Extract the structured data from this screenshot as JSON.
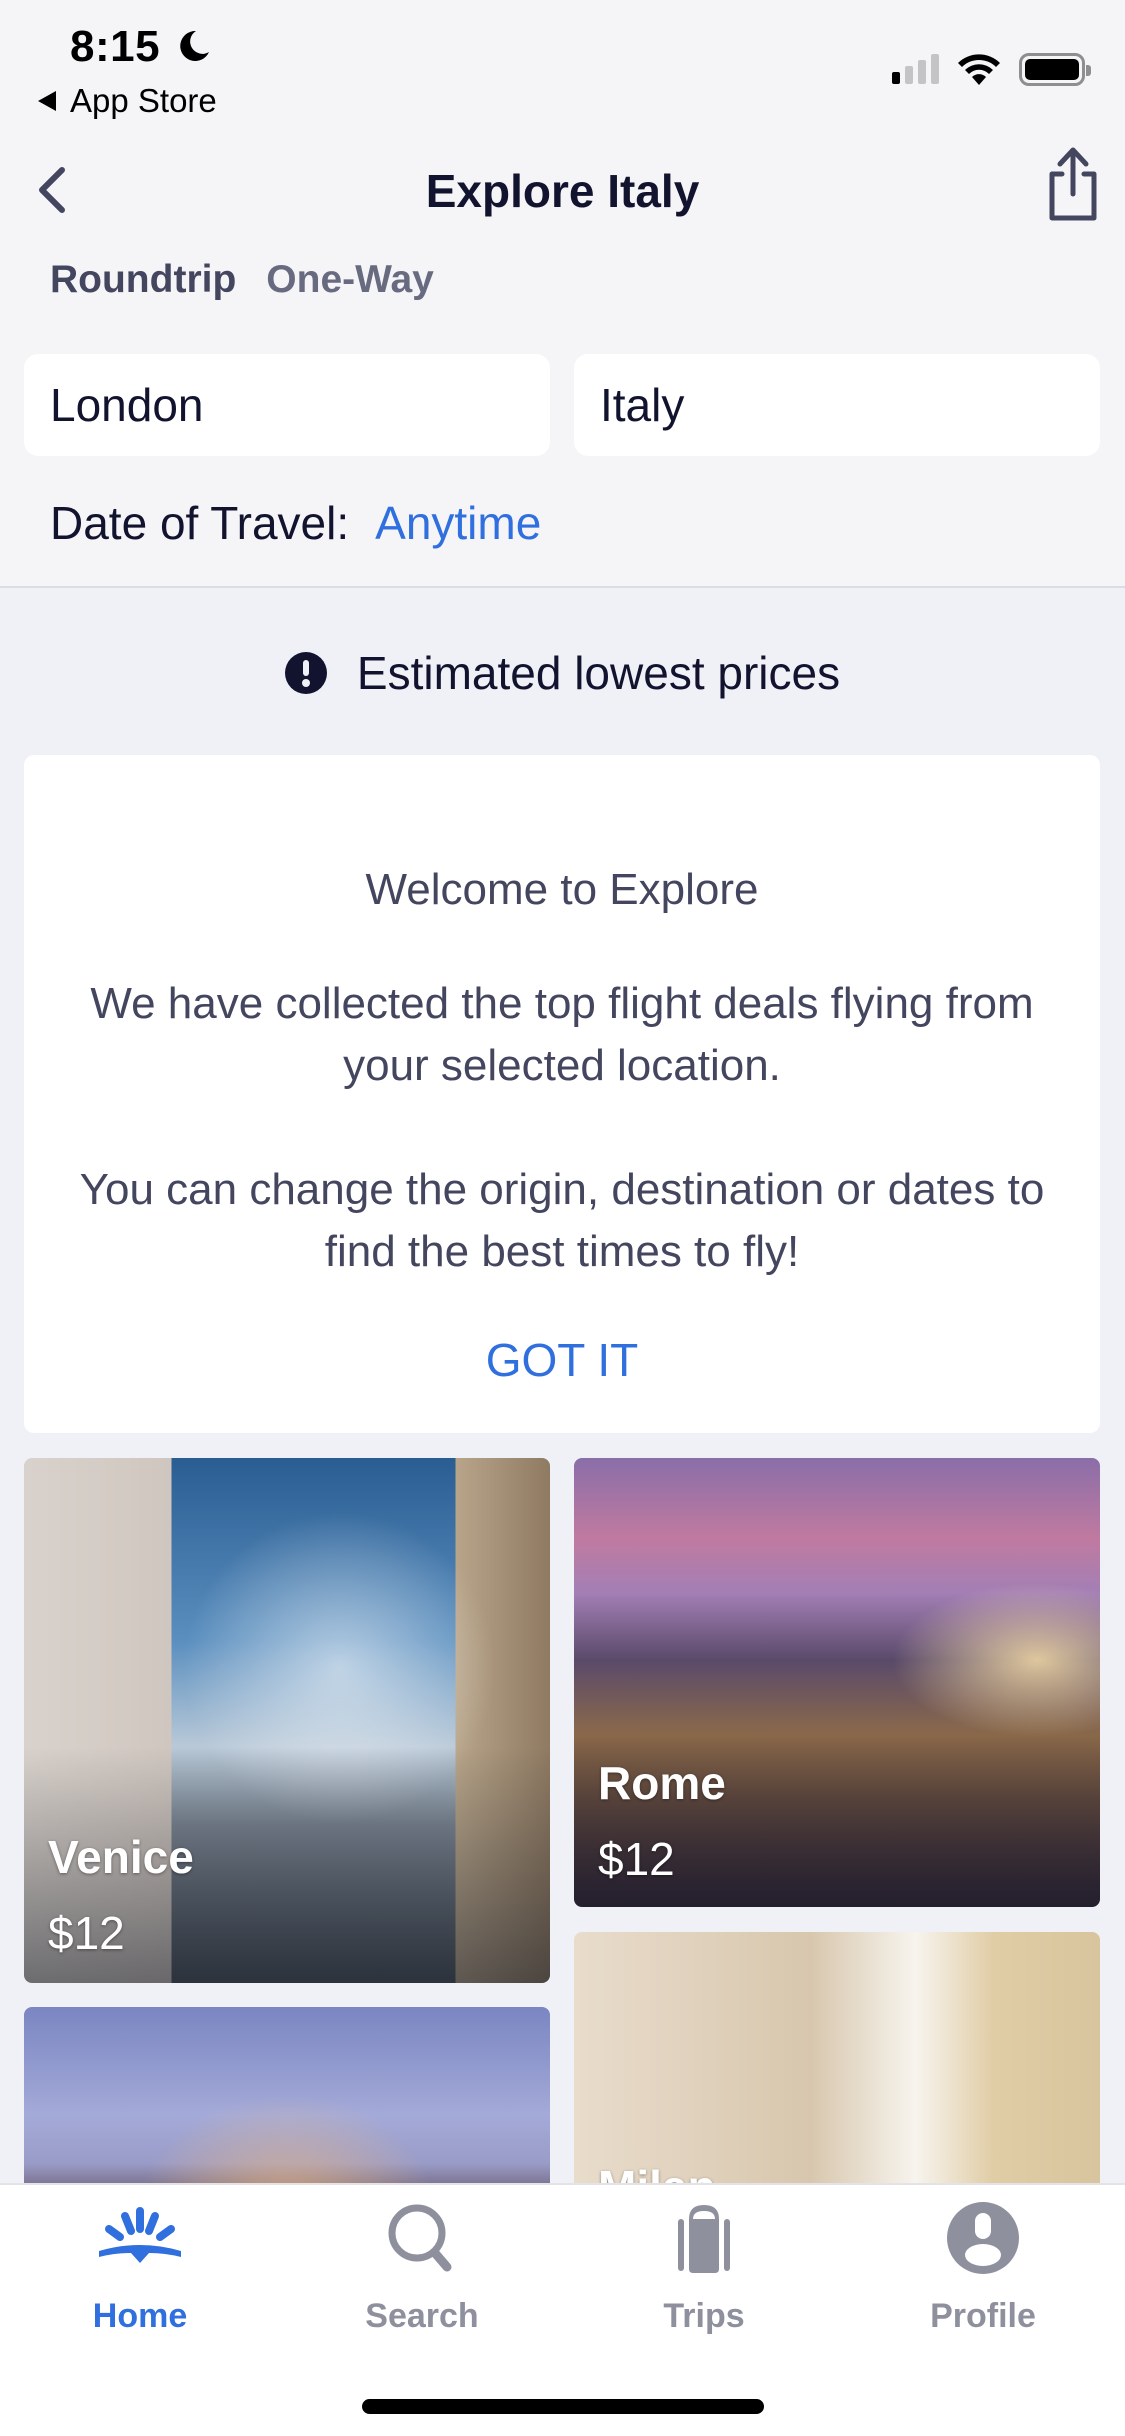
{
  "status_bar": {
    "time": "8:15",
    "back_app": "App Store",
    "signal_bars_filled": 1,
    "signal_bars_total": 4,
    "battery_level": 0.95
  },
  "nav": {
    "title": "Explore Italy",
    "back_icon": "chevron-left-icon",
    "share_icon": "share-icon"
  },
  "trip_type": {
    "options": [
      "Roundtrip",
      "One-Way"
    ],
    "selected": "Roundtrip"
  },
  "search": {
    "origin": "London",
    "destination": "Italy",
    "date_label": "Date of Travel:",
    "date_value": "Anytime"
  },
  "banner": {
    "icon": "alert-circle-icon",
    "text": "Estimated lowest prices"
  },
  "welcome": {
    "title": "Welcome to Explore",
    "paragraph1": "We have collected the top flight deals flying from your selected location.",
    "paragraph2": "You can change the origin, destination or dates to find the best times to fly!",
    "button": "GOT IT"
  },
  "destinations": [
    {
      "name": "Venice",
      "price": "$12"
    },
    {
      "name": "Rome",
      "price": "$12"
    },
    {
      "name": "Milan",
      "price": ""
    },
    {
      "name": "",
      "price": ""
    }
  ],
  "tabbar": {
    "items": [
      {
        "label": "Home",
        "icon": "home-sunrise-icon",
        "active": true
      },
      {
        "label": "Search",
        "icon": "search-icon",
        "active": false
      },
      {
        "label": "Trips",
        "icon": "suitcase-icon",
        "active": false
      },
      {
        "label": "Profile",
        "icon": "profile-icon",
        "active": false
      }
    ]
  },
  "colors": {
    "accent": "#2f6fde",
    "text_dark": "#12132f",
    "text_muted": "#44465f",
    "tab_inactive": "#8e909d",
    "background": "#f5f5f8"
  }
}
